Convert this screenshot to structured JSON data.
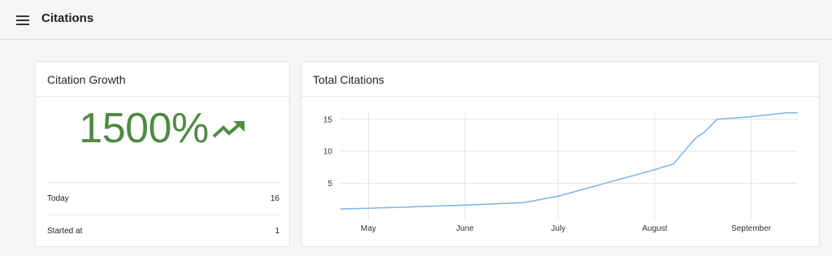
{
  "header": {
    "title": "Citations",
    "menu_icon": "hamburger-menu-icon"
  },
  "growth_card": {
    "title": "Citation Growth",
    "value": "1500%",
    "trend_icon": "trending-up-icon",
    "accent_color": "#4e8b43",
    "rows": [
      {
        "label": "Today",
        "value": "16"
      },
      {
        "label": "Started at",
        "value": "1"
      }
    ]
  },
  "total_card": {
    "title": "Total Citations"
  },
  "chart_data": {
    "type": "line",
    "title": "Total Citations",
    "x_ticks": [
      "May",
      "June",
      "July",
      "August",
      "September"
    ],
    "y_ticks": [
      5,
      10,
      15
    ],
    "ylim": [
      0,
      17
    ],
    "grid": true,
    "series": [
      {
        "color": "#7db3e8",
        "points": [
          [
            "Apr 22",
            1
          ],
          [
            "May 1",
            1.1
          ],
          [
            "Jun 1",
            1.6
          ],
          [
            "Jun 20",
            2
          ],
          [
            "Jul 1",
            3
          ],
          [
            "Jul 31",
            7
          ],
          [
            "Aug 7",
            8
          ],
          [
            "Aug 14",
            12
          ],
          [
            "Aug 17",
            13
          ],
          [
            "Aug 21",
            15
          ],
          [
            "Sep 1",
            15.4
          ],
          [
            "Sep 12",
            16
          ],
          [
            "Sep 16",
            16
          ]
        ]
      }
    ]
  }
}
